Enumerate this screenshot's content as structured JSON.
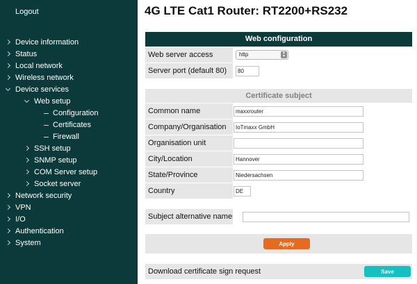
{
  "sidebar": {
    "logout": "Logout",
    "nav": [
      {
        "label": "Device information",
        "level": 0,
        "marker": "chevron-right"
      },
      {
        "label": "Status",
        "level": 0,
        "marker": "chevron-right"
      },
      {
        "label": "Local network",
        "level": 0,
        "marker": "chevron-right"
      },
      {
        "label": "Wireless network",
        "level": 0,
        "marker": "chevron-right"
      },
      {
        "label": "Device services",
        "level": 0,
        "marker": "chevron-down"
      },
      {
        "label": "Web setup",
        "level": 1,
        "marker": "chevron-down"
      },
      {
        "label": "Configuration",
        "level": 2,
        "marker": "dash"
      },
      {
        "label": "Certificates",
        "level": 2,
        "marker": "dash"
      },
      {
        "label": "Firewall",
        "level": 2,
        "marker": "dash"
      },
      {
        "label": "SSH setup",
        "level": 1,
        "marker": "chevron-right"
      },
      {
        "label": "SNMP setup",
        "level": 1,
        "marker": "chevron-right"
      },
      {
        "label": "COM Server setup",
        "level": 1,
        "marker": "chevron-right"
      },
      {
        "label": "Socket server",
        "level": 1,
        "marker": "chevron-right"
      },
      {
        "label": "Network security",
        "level": 0,
        "marker": "chevron-right"
      },
      {
        "label": "VPN",
        "level": 0,
        "marker": "chevron-right"
      },
      {
        "label": "I/O",
        "level": 0,
        "marker": "chevron-right"
      },
      {
        "label": "Authentication",
        "level": 0,
        "marker": "chevron-right"
      },
      {
        "label": "System",
        "level": 0,
        "marker": "chevron-right"
      }
    ]
  },
  "page": {
    "title": "4G LTE Cat1 Router: RT2200+RS232"
  },
  "web_config": {
    "header": "Web configuration",
    "access_label": "Web server access",
    "access_value": "http",
    "port_label": "Server port (default 80)",
    "port_value": "80"
  },
  "certificate": {
    "header": "Certificate subject",
    "common_name_label": "Common name",
    "common_name_value": "maxxrouter",
    "company_label": "Company/Organisation",
    "company_value": "IoTmaxx GmbH",
    "unit_label": "Organisation unit",
    "unit_value": "",
    "city_label": "City/Location",
    "city_value": "Hannover",
    "state_label": "State/Province",
    "state_value": "Niedersachsen",
    "country_label": "Country",
    "country_value": "DE",
    "san_label": "Subject alternative names",
    "san_value": ""
  },
  "actions": {
    "apply_label": "Apply",
    "download_label": "Download certificate sign request",
    "save_label": "Save"
  },
  "colors": {
    "sidebar_bg": "#0c3a3a",
    "row_bg": "#e6e6e6",
    "apply_button": "#e46b1f",
    "save_button": "#17c0c0"
  }
}
